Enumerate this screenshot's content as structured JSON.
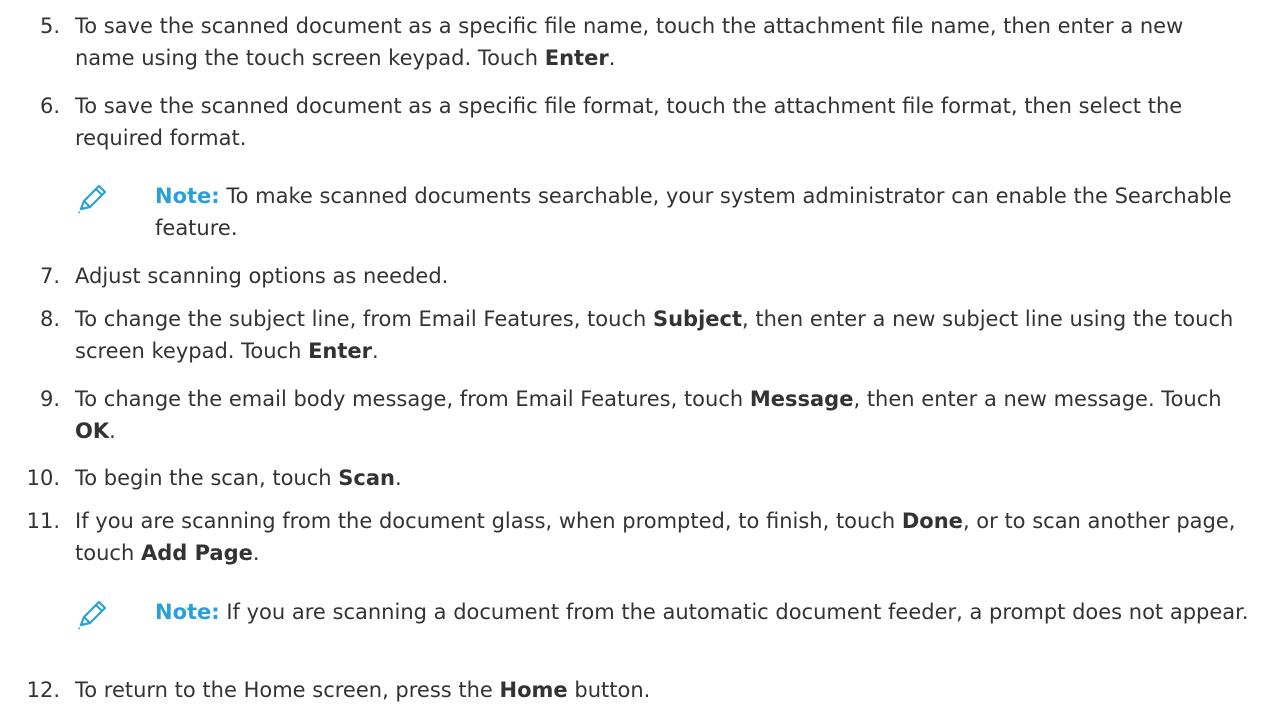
{
  "steps": [
    {
      "num": "5.",
      "parts": [
        {
          "t": "To save the scanned document as a specific file name, touch the attachment file name, then enter a new name using the touch screen keypad. Touch "
        },
        {
          "t": "Enter",
          "b": true
        },
        {
          "t": "."
        }
      ]
    },
    {
      "num": "6.",
      "parts": [
        {
          "t": "To save the scanned document as a specific file format, touch the attachment file format, then select the required format."
        }
      ]
    },
    {
      "num": "7.",
      "parts": [
        {
          "t": "Adjust scanning options as needed."
        }
      ]
    },
    {
      "num": "8.",
      "parts": [
        {
          "t": "To change the subject line, from Email Features, touch "
        },
        {
          "t": "Subject",
          "b": true
        },
        {
          "t": ", then enter a new subject line using the touch screen keypad. Touch "
        },
        {
          "t": "Enter",
          "b": true
        },
        {
          "t": "."
        }
      ]
    },
    {
      "num": "9.",
      "parts": [
        {
          "t": "To change the email body message, from Email Features, touch "
        },
        {
          "t": "Message",
          "b": true
        },
        {
          "t": ", then enter a new message. Touch "
        },
        {
          "t": "OK",
          "b": true
        },
        {
          "t": "."
        }
      ]
    },
    {
      "num": "10.",
      "parts": [
        {
          "t": "To begin the scan, touch "
        },
        {
          "t": "Scan",
          "b": true
        },
        {
          "t": "."
        }
      ]
    },
    {
      "num": "11.",
      "parts": [
        {
          "t": "If you are scanning from the document glass, when prompted, to finish, touch "
        },
        {
          "t": "Done",
          "b": true
        },
        {
          "t": ", or to scan another page, touch "
        },
        {
          "t": "Add Page",
          "b": true
        },
        {
          "t": "."
        }
      ]
    },
    {
      "num": "12.",
      "parts": [
        {
          "t": "To return to the Home screen, press the "
        },
        {
          "t": "Home",
          "b": true
        },
        {
          "t": " button."
        }
      ]
    }
  ],
  "notes": [
    {
      "label": "Note:",
      "text": " To make scanned documents searchable, your system administrator can enable the Searchable feature."
    },
    {
      "label": "Note:",
      "text": " If you are scanning a document from the automatic document feeder, a prompt does not appear."
    }
  ],
  "colors": {
    "note_label": "#2b9fd9",
    "body_text": "#333333",
    "icon": "#2b9fd9"
  },
  "icons": {
    "note": "pencil-icon"
  }
}
